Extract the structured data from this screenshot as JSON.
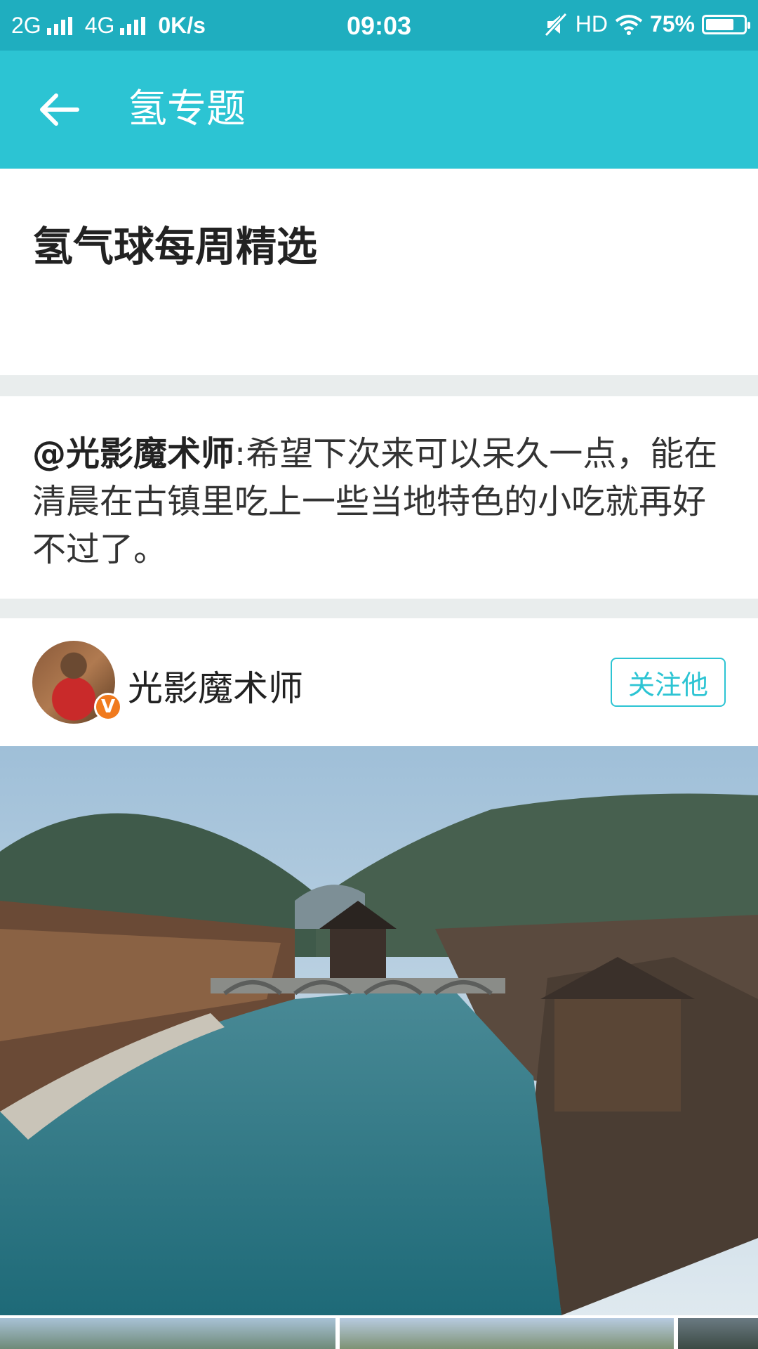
{
  "status_bar": {
    "network_1": "2G",
    "network_2": "4G",
    "speed": "0K/s",
    "time": "09:03",
    "hd": "HD",
    "battery_percent": "75%",
    "battery_level": 0.75
  },
  "app_bar": {
    "title": "氢专题"
  },
  "section": {
    "title": "氢气球每周精选"
  },
  "quote": {
    "author": "@光影魔术师",
    "separator": ":",
    "text": "希望下次来可以呆久一点，能在清晨在古镇里吃上一些当地特色的小吃就再好不过了。"
  },
  "user": {
    "name": "光影魔术师",
    "badge": "V",
    "follow_label": "关注他"
  },
  "colors": {
    "status_bar": "#1faebf",
    "app_bar": "#2cc4d3",
    "accent": "#2cc4d3",
    "badge": "#f07a1e"
  }
}
